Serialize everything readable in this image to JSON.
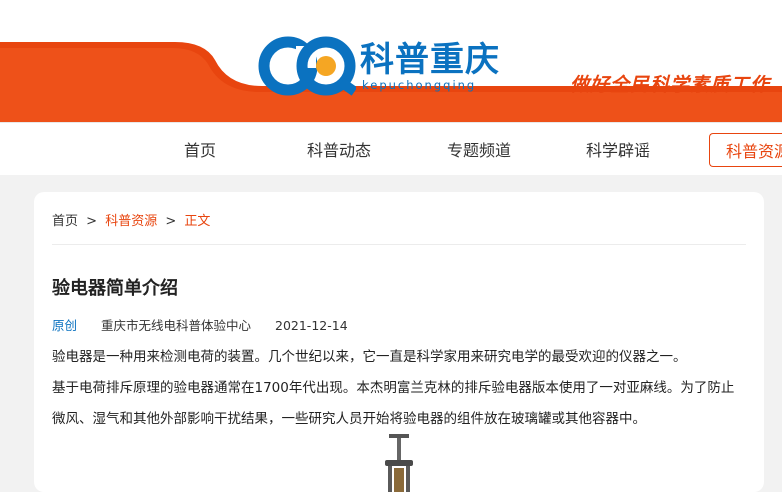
{
  "header": {
    "logo_text": "科普重庆",
    "logo_subtext": "kepuchongqing",
    "slogan": "做好全民科学素质工作",
    "colors": {
      "primary": "#e8450f",
      "brand_blue": "#0b72c0"
    }
  },
  "nav": {
    "items": [
      {
        "label": "首页"
      },
      {
        "label": "科普动态"
      },
      {
        "label": "专题频道"
      },
      {
        "label": "科学辟谣"
      },
      {
        "label": "科普资源"
      }
    ],
    "active_index": 4
  },
  "breadcrumb": {
    "home": "首页",
    "sep": ">",
    "section": "科普资源",
    "current": "正文"
  },
  "article": {
    "title": "验电器简单介绍",
    "tag": "原创",
    "source": "重庆市无线电科普体验中心",
    "date": "2021-12-14",
    "paragraphs": [
      "验电器是一种用来检测电荷的装置。几个世纪以来，它一直是科学家用来研究电学的最受欢迎的仪器之一。",
      "基于电荷排斥原理的验电器通常在1700年代出现。本杰明富兰克林的排斥验电器版本使用了一对亚麻线。为了防止微风、湿气和其他外部影响干扰结果，一些研究人员开始将验电器的组件放在玻璃罐或其他容器中。"
    ]
  }
}
